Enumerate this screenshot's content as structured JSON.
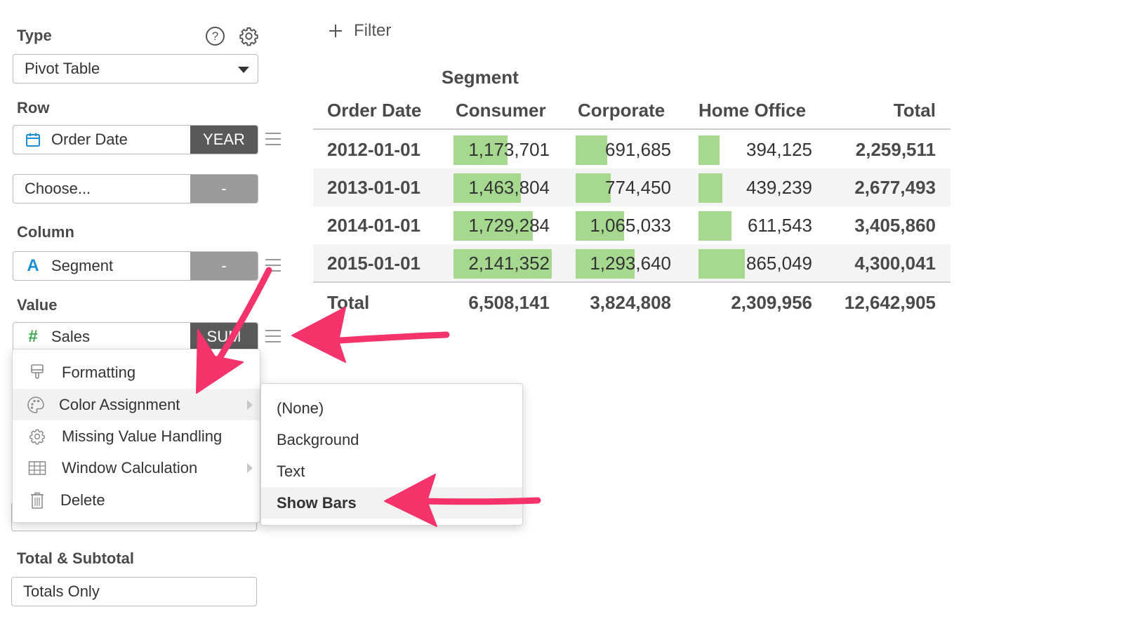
{
  "sidebar": {
    "type_label": "Type",
    "type_value": "Pivot Table",
    "row_label": "Row",
    "row_field1": {
      "name": "Order Date",
      "tag": "YEAR"
    },
    "row_field2": {
      "name": "Choose...",
      "tag": "-"
    },
    "column_label": "Column",
    "column_field": {
      "name": "Segment",
      "tag": "-"
    },
    "value_label": "Value",
    "value_field": {
      "name": "Sales",
      "tag": "SUM"
    },
    "total_label": "Total & Subtotal",
    "total_value": "Totals Only"
  },
  "filter": {
    "label": "Filter"
  },
  "pivot": {
    "column_group": "Segment",
    "headers": [
      "Order Date",
      "Consumer",
      "Corporate",
      "Home Office",
      "Total"
    ],
    "rows": [
      {
        "date": "2012-01-01",
        "consumer": "1,173,701",
        "corporate": "691,685",
        "home_office": "394,125",
        "total": "2,259,511"
      },
      {
        "date": "2013-01-01",
        "consumer": "1,463,804",
        "corporate": "774,450",
        "home_office": "439,239",
        "total": "2,677,493"
      },
      {
        "date": "2014-01-01",
        "consumer": "1,729,284",
        "corporate": "1,065,033",
        "home_office": "611,543",
        "total": "3,405,860"
      },
      {
        "date": "2015-01-01",
        "consumer": "2,141,352",
        "corporate": "1,293,640",
        "home_office": "865,049",
        "total": "4,300,041"
      }
    ],
    "total_row": {
      "label": "Total",
      "consumer": "6,508,141",
      "corporate": "3,824,808",
      "home_office": "2,309,956",
      "total": "12,642,905"
    },
    "bar_fractions": {
      "consumer": [
        0.548,
        0.684,
        0.808,
        1.0
      ],
      "corporate": [
        0.535,
        0.599,
        0.823,
        1.0
      ],
      "home_office": [
        0.456,
        0.508,
        0.707,
        1.0
      ]
    },
    "bar_color": "#a6d98f"
  },
  "context_menu": {
    "items": [
      "Formatting",
      "Color Assignment",
      "Missing Value Handling",
      "Window Calculation",
      "Delete"
    ]
  },
  "submenu": {
    "items": [
      "(None)",
      "Background",
      "Text",
      "Show Bars"
    ],
    "selected": "Show Bars"
  },
  "annotation_color": "#f5336b"
}
